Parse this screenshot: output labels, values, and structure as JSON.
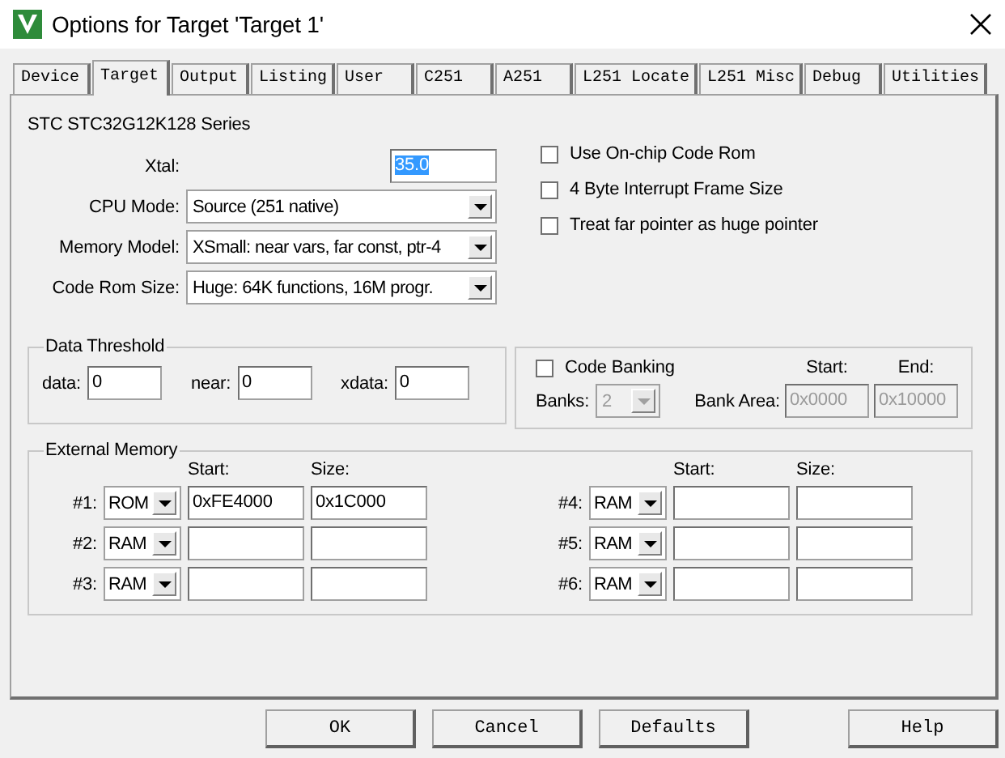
{
  "window": {
    "title": "Options for Target 'Target 1'"
  },
  "tabs": [
    {
      "label": "Device",
      "selected": false
    },
    {
      "label": "Target",
      "selected": true
    },
    {
      "label": "Output",
      "selected": false
    },
    {
      "label": "Listing",
      "selected": false
    },
    {
      "label": "User",
      "selected": false
    },
    {
      "label": "C251",
      "selected": false
    },
    {
      "label": "A251",
      "selected": false
    },
    {
      "label": "L251 Locate",
      "selected": false
    },
    {
      "label": "L251 Misc",
      "selected": false
    },
    {
      "label": "Debug",
      "selected": false
    },
    {
      "label": "Utilities",
      "selected": false
    }
  ],
  "device": "STC STC32G12K128 Series",
  "xtal": {
    "label": "Xtal:",
    "value": "35.0",
    "value_selected": true
  },
  "settings": [
    {
      "label": "CPU Mode:",
      "value": "Source (251 native)"
    },
    {
      "label": "Memory Model:",
      "value": "XSmall: near vars, far const, ptr-4"
    },
    {
      "label": "Code Rom Size:",
      "value": "Huge: 64K functions, 16M progr."
    }
  ],
  "options": [
    {
      "label": "Use On-chip Code Rom",
      "checked": false
    },
    {
      "label": "4 Byte Interrupt Frame Size",
      "checked": false
    },
    {
      "label": "Treat far pointer as huge pointer",
      "checked": false
    }
  ],
  "data_threshold": {
    "title": "Data Threshold",
    "fields": [
      {
        "label": "data:",
        "value": "0"
      },
      {
        "label": "near:",
        "value": "0"
      },
      {
        "label": "xdata:",
        "value": "0"
      }
    ]
  },
  "code_banking": {
    "label": "Code Banking",
    "checked": false,
    "disabled": true,
    "banks_label": "Banks:",
    "banks": "2",
    "bank_area_label": "Bank Area:",
    "start_label": "Start:",
    "end_label": "End:",
    "start": "0x0000",
    "end": "0x10000"
  },
  "external_memory": {
    "title": "External Memory",
    "columns": [
      {
        "start_label": "Start:",
        "size_label": "Size:",
        "rows": [
          {
            "label": "#1:",
            "type": "ROM",
            "start": "0xFE4000",
            "size": "0x1C000"
          },
          {
            "label": "#2:",
            "type": "RAM"
          },
          {
            "label": "#3:",
            "type": "RAM"
          }
        ]
      },
      {
        "start_label": "Start:",
        "size_label": "Size:",
        "rows": [
          {
            "label": "#4:",
            "type": "RAM"
          },
          {
            "label": "#5:",
            "type": "RAM"
          },
          {
            "label": "#6:",
            "type": "RAM"
          }
        ]
      }
    ]
  },
  "buttons": [
    {
      "label": "OK"
    },
    {
      "label": "Cancel"
    },
    {
      "label": "Defaults"
    },
    {
      "label": "Help"
    }
  ]
}
